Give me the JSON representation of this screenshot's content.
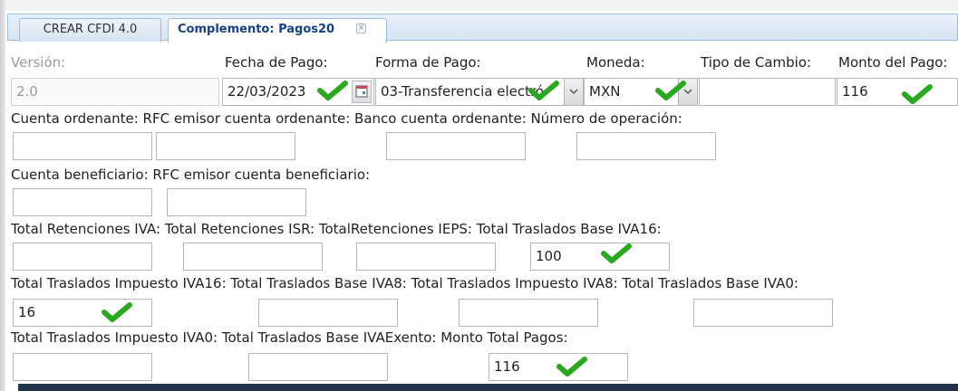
{
  "tabs": {
    "inactive_label": "CREAR CFDI 4.0",
    "active_label": "Complemento: Pagos20",
    "close_glyph": "×"
  },
  "row1": {
    "version_label": "Versión:",
    "version_value": "2.0",
    "fecha_label": "Fecha de Pago:",
    "fecha_value": "22/03/2023",
    "forma_label": "Forma de Pago:",
    "forma_value": "03-Transferencia electró",
    "moneda_label": "Moneda:",
    "moneda_value": "MXN",
    "tipo_cambio_label": "Tipo de Cambio:",
    "tipo_cambio_value": "",
    "monto_label": "Monto del Pago:",
    "monto_value": "116"
  },
  "row2": {
    "labels": "Cuenta ordenante: RFC emisor cuenta ordenante: Banco cuenta ordenante: Número de operación:",
    "values": [
      "",
      "",
      "",
      ""
    ]
  },
  "row3": {
    "labels": "Cuenta beneficiario: RFC emisor cuenta beneficiario:",
    "values": [
      "",
      ""
    ]
  },
  "row4": {
    "labels": "Total Retenciones IVA: Total Retenciones ISR: TotalRetenciones IEPS: Total Traslados Base IVA16:",
    "values": [
      "",
      "",
      "",
      "100"
    ]
  },
  "row5": {
    "labels": "Total Traslados Impuesto IVA16: Total Traslados Base IVA8: Total Traslados Impuesto IVA8: Total Traslados Base IVA0:",
    "values": [
      "16",
      "",
      "",
      ""
    ]
  },
  "row6": {
    "labels": "Total Traslados Impuesto IVA0: Total Traslados Base IVAExento: Monto Total Pagos:",
    "values": [
      "",
      "",
      "116"
    ]
  },
  "colors": {
    "check": "#2aa81e",
    "active_tab_text": "#15428b",
    "tab_border": "#99bbe8"
  }
}
